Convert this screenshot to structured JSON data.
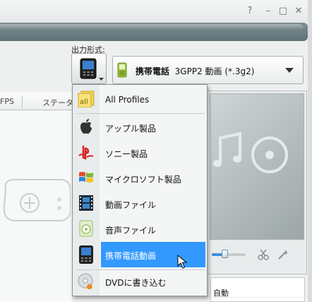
{
  "window": {
    "controls": [
      "?",
      "–",
      "□",
      "✕"
    ]
  },
  "output": {
    "label": "出力形式:",
    "selected_category": "携帯電話",
    "selected_format": "3GPP2 動画 (*.3g2)"
  },
  "left_tabs": [
    "FPS",
    "ステータス"
  ],
  "menu": {
    "items": [
      {
        "label": "All Profiles",
        "icon": "all-profiles-icon",
        "selected": false
      },
      {
        "label": "アップル製品",
        "icon": "apple-icon",
        "selected": false
      },
      {
        "label": "ソニー製品",
        "icon": "playstation-icon",
        "selected": false
      },
      {
        "label": "マイクロソフト製品",
        "icon": "windows-icon",
        "selected": false
      },
      {
        "label": "動画ファイル",
        "icon": "film-icon",
        "selected": false
      },
      {
        "label": "音声ファイル",
        "icon": "audio-icon",
        "selected": false
      },
      {
        "label": "携帯電話動画",
        "icon": "mobile-phone-icon",
        "selected": true
      },
      {
        "label": "DVDに書き込む",
        "icon": "dvd-burn-icon",
        "selected": false
      }
    ]
  },
  "preview": {
    "seek_position": 0.35
  },
  "settings_table": {
    "value": "自動"
  },
  "colors": {
    "selection": "#3399ff",
    "banner": "#6f8184"
  }
}
